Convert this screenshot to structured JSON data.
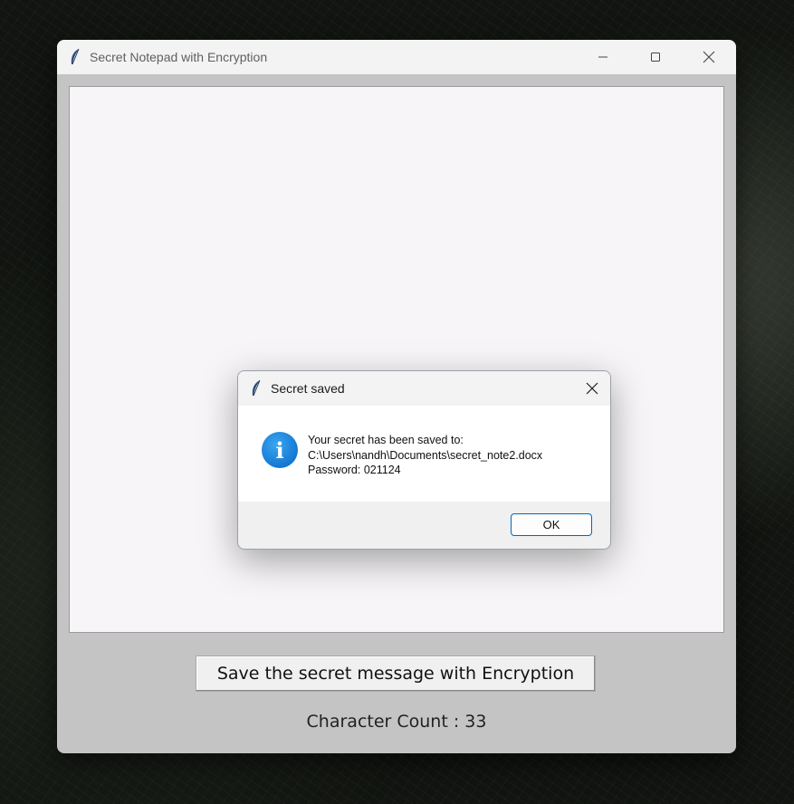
{
  "window": {
    "title": "Secret Notepad with Encryption",
    "controls": {
      "minimize": "minimize-icon",
      "maximize": "maximize-icon",
      "close": "close-icon"
    },
    "editor_text": "",
    "save_button_label": "Save the secret message with Encryption",
    "character_count_label": "Character Count : 33"
  },
  "dialog": {
    "title": "Secret saved",
    "icon": "info-icon",
    "info_glyph": "i",
    "message_lines": [
      "Your secret has been saved to:",
      "C:\\Users\\nandh\\Documents\\secret_note2.docx",
      "Password: 021124"
    ],
    "ok_label": "OK"
  },
  "colors": {
    "accent": "#0067c0",
    "info_blue": "#1478d4",
    "window_body": "#c4c4c4",
    "editor_bg": "#f7f5f7"
  }
}
